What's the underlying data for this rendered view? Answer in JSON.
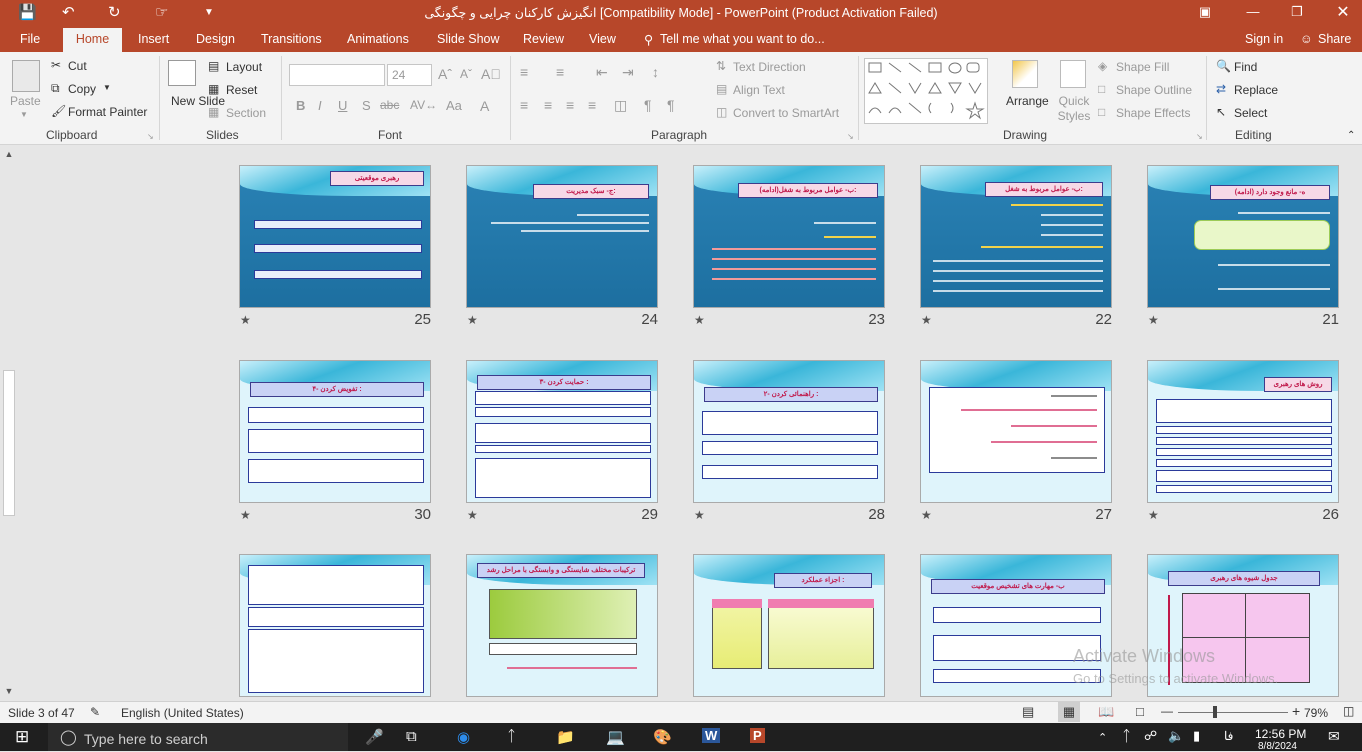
{
  "titlebar": {
    "title": "انگیزش کارکنان چرایی و چگونگی [Compatibility Mode] - PowerPoint (Product Activation Failed)",
    "save_icon": "save-icon",
    "undo_icon": "undo-icon",
    "redo_icon": "redo-icon"
  },
  "tabs": {
    "file": "File",
    "home": "Home",
    "insert": "Insert",
    "design": "Design",
    "transitions": "Transitions",
    "animations": "Animations",
    "slideshow": "Slide Show",
    "review": "Review",
    "view": "View",
    "tell": "Tell me what you want to do...",
    "signin": "Sign in",
    "share": "Share"
  },
  "ribbon": {
    "paste": "Paste",
    "cut": "Cut",
    "copy": "Copy",
    "format_painter": "Format Painter",
    "clipboard": "Clipboard",
    "new_slide": "New Slide",
    "layout": "Layout",
    "reset": "Reset",
    "section": "Section",
    "slides": "Slides",
    "font_size": "24",
    "font": "Font",
    "text_direction": "Text Direction",
    "align_text": "Align Text",
    "convert_smartart": "Convert to SmartArt",
    "paragraph": "Paragraph",
    "arrange": "Arrange",
    "quick_styles": "Quick Styles",
    "shape_fill": "Shape Fill",
    "shape_outline": "Shape Outline",
    "shape_effects": "Shape Effects",
    "drawing": "Drawing",
    "find": "Find",
    "replace": "Replace",
    "select": "Select",
    "editing": "Editing"
  },
  "slides": [
    {
      "number": "25",
      "title": "رهبری موقعیتی"
    },
    {
      "number": "24",
      "title": "ج- سبک مدیریت:"
    },
    {
      "number": "23",
      "title": "ب- عوامل مربوط به شغل(ادامه):"
    },
    {
      "number": "22",
      "title": "ب- عوامل مربوط به شغل:"
    },
    {
      "number": "21",
      "title": "ه- مانع وجود دارد (ادامه)"
    },
    {
      "number": "30",
      "title": "۴- تفویض کردن :"
    },
    {
      "number": "29",
      "title": "۳- حمایت کردن :"
    },
    {
      "number": "28",
      "title": "۲- راهنمائی کردن :"
    },
    {
      "number": "27",
      "title": ""
    },
    {
      "number": "26",
      "title": "روش های رهبری"
    },
    {
      "number": "",
      "title": ""
    },
    {
      "number": "",
      "title": "ترکیبات مختلف شایستگی و وابستگی با مراحل رشد"
    },
    {
      "number": "",
      "title": "اجزاء عملکرد :"
    },
    {
      "number": "",
      "title": "ب- مهارت های تشخیص موقعیت"
    },
    {
      "number": "",
      "title": "جدول شیوه های رهبری"
    }
  ],
  "statusbar": {
    "slide_of": "Slide 3 of 47",
    "language": "English (United States)",
    "zoom": "79%"
  },
  "watermark": {
    "line1": "Activate Windows",
    "line2": "Go to Settings to activate Windows."
  },
  "taskbar": {
    "search_placeholder": "Type here to search",
    "time": "12:56 PM",
    "date": "8/8/2024",
    "lang": "فا"
  }
}
